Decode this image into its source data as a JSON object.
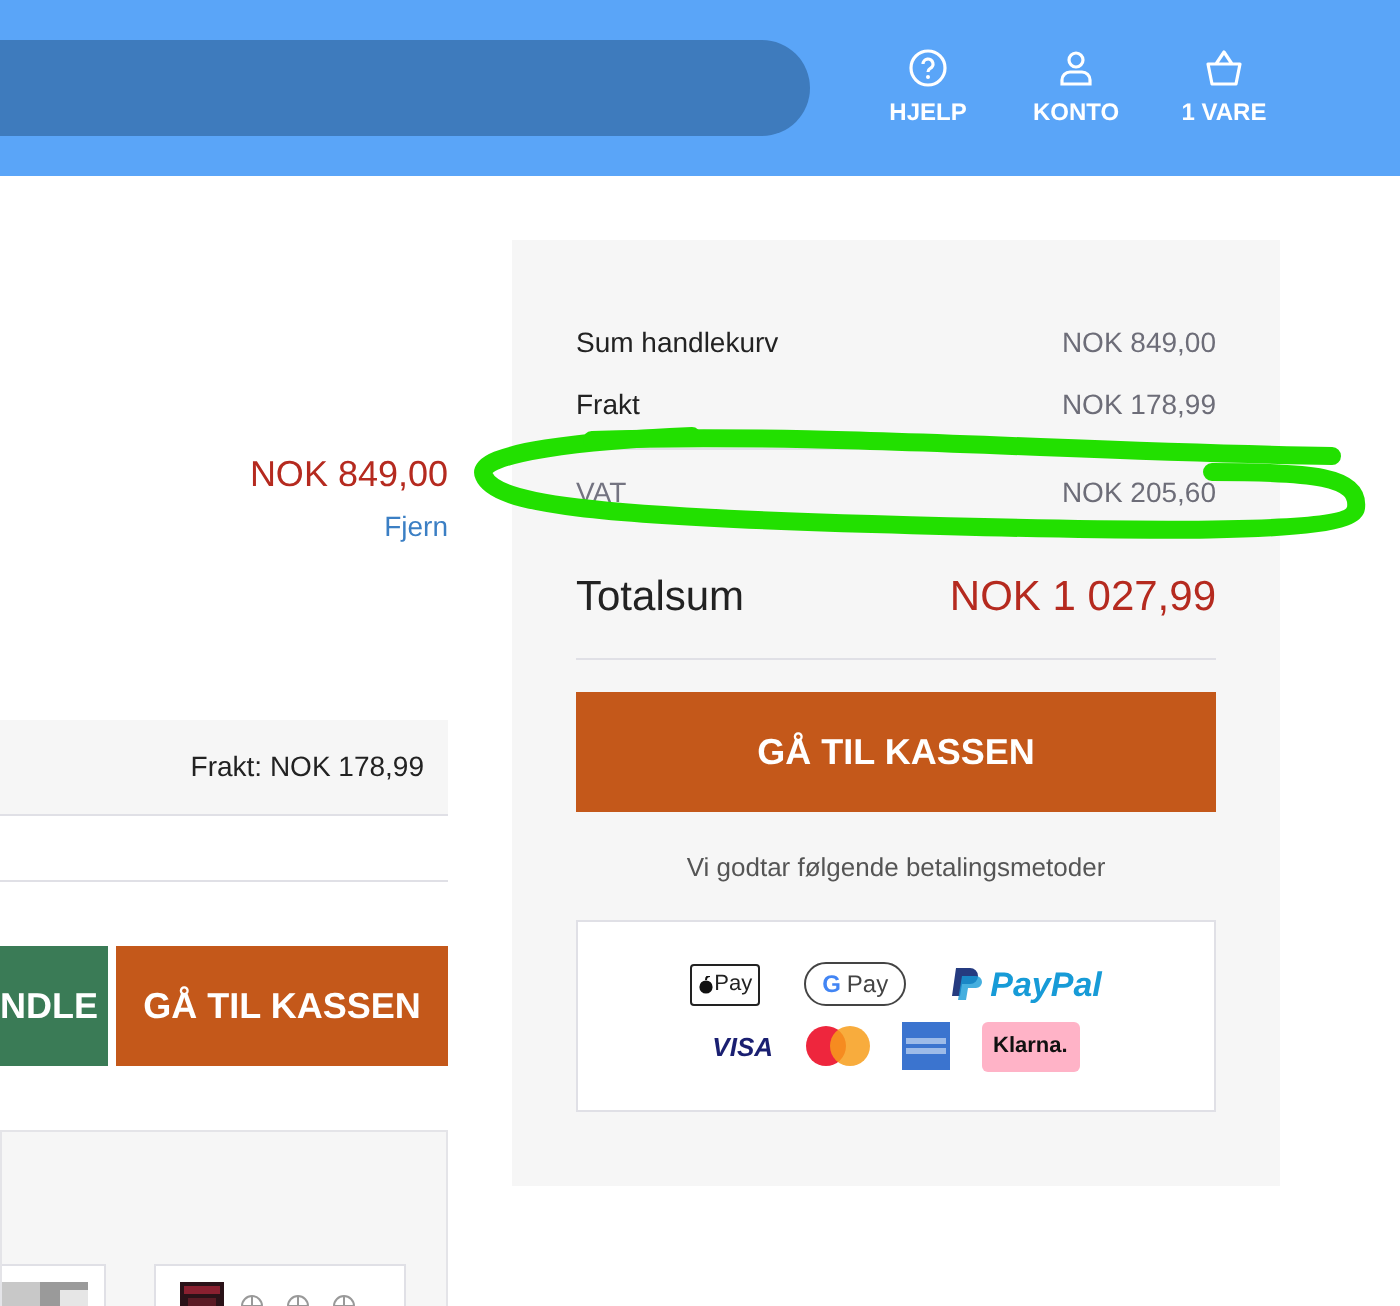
{
  "header": {
    "nav": [
      {
        "kind": "help",
        "label": "HJELP"
      },
      {
        "kind": "account",
        "label": "KONTO"
      },
      {
        "kind": "basket",
        "label": "1 VARE"
      }
    ]
  },
  "cart": {
    "line_price": "NOK 849,00",
    "remove_link": "Fjern",
    "shipping_note": "Frakt: NOK 178,99",
    "buttons": [
      {
        "kind": "continue",
        "label": "NDLE"
      },
      {
        "kind": "checkout",
        "label": "GÅ TIL KASSEN"
      }
    ]
  },
  "summary": {
    "rows": [
      {
        "label": "Sum handlekurv",
        "value": "NOK 849,00",
        "muted": false
      },
      {
        "label": "Frakt",
        "value": "NOK 178,99",
        "muted": false
      },
      {
        "label": "VAT",
        "value": "NOK 205,60",
        "muted": true
      }
    ],
    "total_label": "Totalsum",
    "total_value": "NOK 1 027,99",
    "checkout_button": "GÅ TIL KASSEN",
    "payment_note": "Vi godtar følgende betalingsmetoder",
    "payment_methods": [
      {
        "kind": "applepay",
        "label": "Pay"
      },
      {
        "kind": "googlepay",
        "mark": "G",
        "label": "Pay"
      },
      {
        "kind": "paypal",
        "label": "PayPal"
      },
      {
        "kind": "visa",
        "label": "VISA"
      },
      {
        "kind": "mastercard"
      },
      {
        "kind": "amex"
      },
      {
        "kind": "klarna",
        "label": "Klarna."
      }
    ]
  },
  "annotation": {
    "kind": "ring",
    "color": "#22e000"
  }
}
